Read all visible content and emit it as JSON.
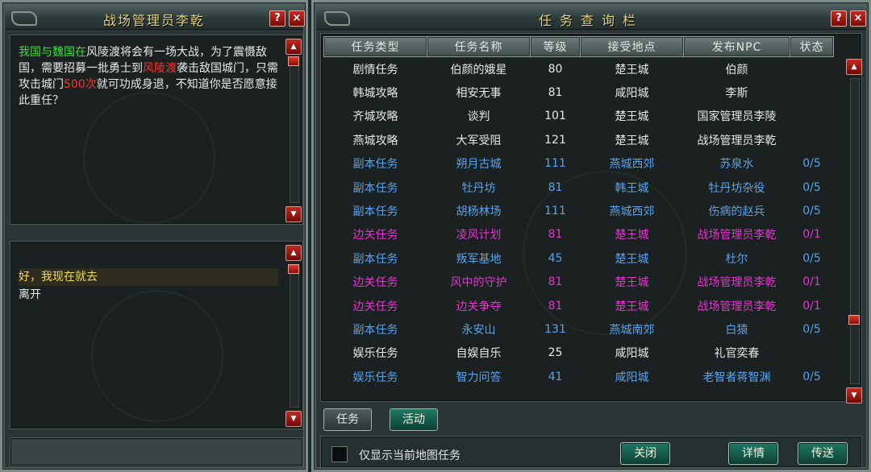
{
  "npc_dialog": {
    "title": "战场管理员李乾",
    "help_label": "?",
    "close_label": "×",
    "message": {
      "part1": "我国与",
      "part2": "魏国在",
      "part3": "风陵渡将会有一场大战，为了震慑敌国，需要招募一批勇士到",
      "part4": "风陵渡",
      "part5": "袭击敌国城门，只需攻击城门",
      "part6": "500次",
      "part7": "就可功成身退，不知道你是否愿意接此重任？"
    },
    "options": [
      "好，我现在就去",
      "离开"
    ]
  },
  "task_panel": {
    "title": "任务查询栏",
    "help_label": "?",
    "close_label": "×",
    "columns": [
      "任务类型",
      "任务名称",
      "等级",
      "接受地点",
      "发布NPC",
      "状态"
    ],
    "rows": [
      {
        "kind": "plot",
        "type": "剧情任务",
        "name": "伯颜的娥星",
        "level": "80",
        "place": "楚王城",
        "npc": "伯颜",
        "status": ""
      },
      {
        "kind": "plot",
        "type": "韩城攻略",
        "name": "相安无事",
        "level": "81",
        "place": "咸阳城",
        "npc": "李斯",
        "status": ""
      },
      {
        "kind": "plot",
        "type": "齐城攻略",
        "name": "谈判",
        "level": "101",
        "place": "楚王城",
        "npc": "国家管理员李陵",
        "status": ""
      },
      {
        "kind": "plot",
        "type": "燕城攻略",
        "name": "大军受阻",
        "level": "121",
        "place": "楚王城",
        "npc": "战场管理员李乾",
        "status": ""
      },
      {
        "kind": "dungeon",
        "type": "副本任务",
        "name": "朔月古城",
        "level": "111",
        "place": "燕城西郊",
        "npc": "苏泉水",
        "status": "0/5"
      },
      {
        "kind": "dungeon",
        "type": "副本任务",
        "name": "牡丹坊",
        "level": "81",
        "place": "韩王城",
        "npc": "牡丹坊杂役",
        "status": "0/5"
      },
      {
        "kind": "dungeon",
        "type": "副本任务",
        "name": "胡杨林场",
        "level": "111",
        "place": "燕城西郊",
        "npc": "伤病的赵兵",
        "status": "0/5"
      },
      {
        "kind": "border",
        "type": "边关任务",
        "name": "凌风计划",
        "level": "81",
        "place": "楚王城",
        "npc": "战场管理员李乾",
        "status": "0/1"
      },
      {
        "kind": "dungeon",
        "type": "副本任务",
        "name": "叛军基地",
        "level": "45",
        "place": "楚王城",
        "npc": "杜尔",
        "status": "0/5"
      },
      {
        "kind": "border",
        "type": "边关任务",
        "name": "风中的守护",
        "level": "81",
        "place": "楚王城",
        "npc": "战场管理员李乾",
        "status": "0/1"
      },
      {
        "kind": "border",
        "type": "边关任务",
        "name": "边关争夺",
        "level": "81",
        "place": "楚王城",
        "npc": "战场管理员李乾",
        "status": "0/1"
      },
      {
        "kind": "dungeon",
        "type": "副本任务",
        "name": "永安山",
        "level": "131",
        "place": "燕城南郊",
        "npc": "白猿",
        "status": "0/5"
      },
      {
        "kind": "fun",
        "type": "娱乐任务",
        "name": "自娱自乐",
        "level": "25",
        "place": "咸阳城",
        "npc": "礼官奕春",
        "status": ""
      },
      {
        "kind": "fun2",
        "type": "娱乐任务",
        "name": "智力问答",
        "level": "41",
        "place": "咸阳城",
        "npc": "老智者蒋智渊",
        "status": "0/5"
      }
    ],
    "tabs": {
      "task": "任务",
      "activity": "活动"
    },
    "filter_label": "仅显示当前地图任务",
    "buttons": {
      "close": "关闭",
      "detail": "详情",
      "teleport": "传送"
    }
  },
  "colors": {
    "title_gold": "#e8d77a",
    "plot_text": "#e8e8e8",
    "dungeon_text": "#5aa2ea",
    "border_text": "#e236cc",
    "highlight_green": "#39e03a",
    "highlight_red": "#ff3030",
    "option_yellow": "#f0dc50"
  }
}
